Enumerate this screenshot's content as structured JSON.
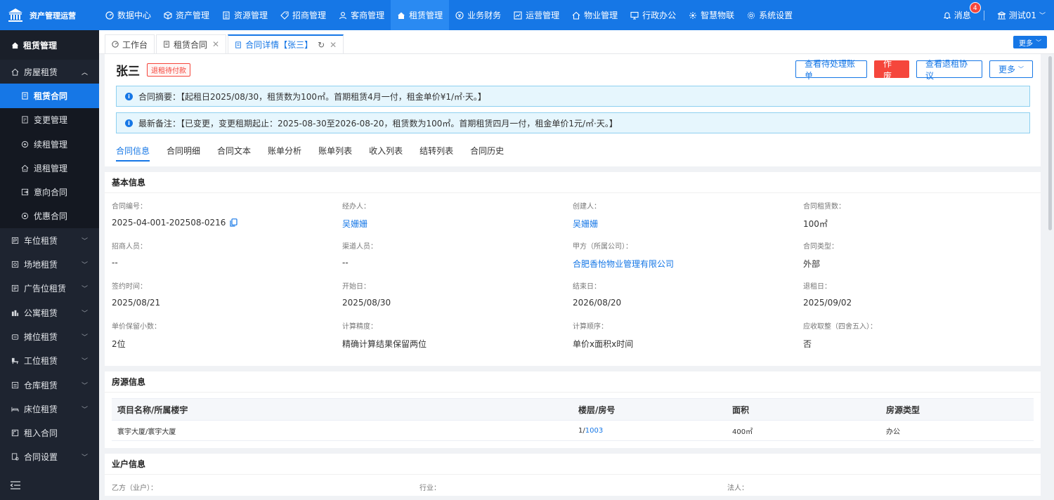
{
  "app": {
    "brand_title": "资产管理运营",
    "nav": [
      {
        "label": "数据中心",
        "icon": "dashboard-icon"
      },
      {
        "label": "资产管理",
        "icon": "cube-icon"
      },
      {
        "label": "资源管理",
        "icon": "building-icon"
      },
      {
        "label": "招商管理",
        "icon": "tag-icon"
      },
      {
        "label": "客商管理",
        "icon": "users-icon"
      },
      {
        "label": "租赁管理",
        "icon": "home-icon"
      },
      {
        "label": "业务财务",
        "icon": "coin-icon"
      },
      {
        "label": "运营管理",
        "icon": "chart-icon"
      },
      {
        "label": "物业管理",
        "icon": "house-icon"
      },
      {
        "label": "行政办公",
        "icon": "monitor-icon"
      },
      {
        "label": "智慧物联",
        "icon": "iot-icon"
      },
      {
        "label": "系统设置",
        "icon": "gear-icon"
      }
    ],
    "messages_label": "消息",
    "messages_count": "4",
    "user_label": "测试01"
  },
  "sidebar": {
    "header": "租赁管理",
    "items": [
      {
        "label": "房屋租赁",
        "level": "group",
        "expanded": true
      },
      {
        "label": "租赁合同",
        "level": "sub",
        "active": true
      },
      {
        "label": "变更管理",
        "level": "sub"
      },
      {
        "label": "续租管理",
        "level": "sub"
      },
      {
        "label": "退租管理",
        "level": "sub"
      },
      {
        "label": "意向合同",
        "level": "sub"
      },
      {
        "label": "优惠合同",
        "level": "sub"
      },
      {
        "label": "车位租赁",
        "level": "group"
      },
      {
        "label": "场地租赁",
        "level": "group"
      },
      {
        "label": "广告位租赁",
        "level": "group"
      },
      {
        "label": "公寓租赁",
        "level": "group"
      },
      {
        "label": "摊位租赁",
        "level": "group"
      },
      {
        "label": "工位租赁",
        "level": "group"
      },
      {
        "label": "仓库租赁",
        "level": "group"
      },
      {
        "label": "床位租赁",
        "level": "group"
      },
      {
        "label": "租入合同",
        "level": "leaf"
      },
      {
        "label": "合同设置",
        "level": "group"
      }
    ]
  },
  "tabs": {
    "items": [
      "工作台",
      "租赁合同",
      "合同详情【张三】"
    ],
    "more_label": "更多"
  },
  "contract": {
    "name": "张三",
    "status_tag": "退租待付款",
    "actions": {
      "pending_bills": "查看待处理账单",
      "void": "作 废",
      "view_termination": "查看退租协议",
      "more": "更多"
    },
    "summary": "合同摘要：【起租日2025/08/30，租赁数为100㎡。首期租赁4月一付，租金单价¥1/㎡·天。】",
    "latest_note": "最新备注：【已变更，变更租期起止：2025-08-30至2026-08-20，租赁数为100㎡。首期租赁四月一付，租金单价1元/㎡·天。】",
    "detail_tabs": [
      "合同信息",
      "合同明细",
      "合同文本",
      "账单分析",
      "账单列表",
      "收入列表",
      "结转列表",
      "合同历史"
    ]
  },
  "basic_info": {
    "title": "基本信息",
    "fields": [
      {
        "label": "合同编号：",
        "value": "2025-04-001-202508-0216"
      },
      {
        "label": "经办人：",
        "value": "吴姗姗"
      },
      {
        "label": "创建人：",
        "value": "吴姗姗"
      },
      {
        "label": "合同租赁数：",
        "value": "100㎡"
      },
      {
        "label": "招商人员：",
        "value": "--"
      },
      {
        "label": "渠道人员：",
        "value": "--"
      },
      {
        "label": "甲方（所属公司）：",
        "value": "合肥香怡物业管理有限公司"
      },
      {
        "label": "合同类型：",
        "value": "外部"
      },
      {
        "label": "签约时间：",
        "value": "2025/08/21"
      },
      {
        "label": "开始日：",
        "value": "2025/08/30"
      },
      {
        "label": "结束日：",
        "value": "2026/08/20"
      },
      {
        "label": "退租日：",
        "value": "2025/09/02"
      },
      {
        "label": "单价保留小数：",
        "value": "2位"
      },
      {
        "label": "计算精度：",
        "value": "精确计算结果保留两位"
      },
      {
        "label": "计算顺序：",
        "value": "单价x面积x时间"
      },
      {
        "label": "应收取整（四舍五入）：",
        "value": "否"
      }
    ]
  },
  "property_info": {
    "title": "房源信息",
    "columns": [
      "项目名称/所属楼宇",
      "楼层/房号",
      "面积",
      "房源类型"
    ],
    "rows": [
      {
        "project": "寰宇大厦/寰宇大厦",
        "floor": "1/",
        "room": "1003",
        "area": "400㎡",
        "type": "办公"
      }
    ]
  },
  "owner_info": {
    "title": "业户信息",
    "fields": [
      {
        "label": "乙方（业户）：",
        "value": ""
      },
      {
        "label": "行业：",
        "value": ""
      },
      {
        "label": "法人：",
        "value": ""
      }
    ]
  },
  "colors": {
    "primary": "#1677e6",
    "danger": "#f5463c",
    "sidebar_bg": "#1e2430"
  }
}
